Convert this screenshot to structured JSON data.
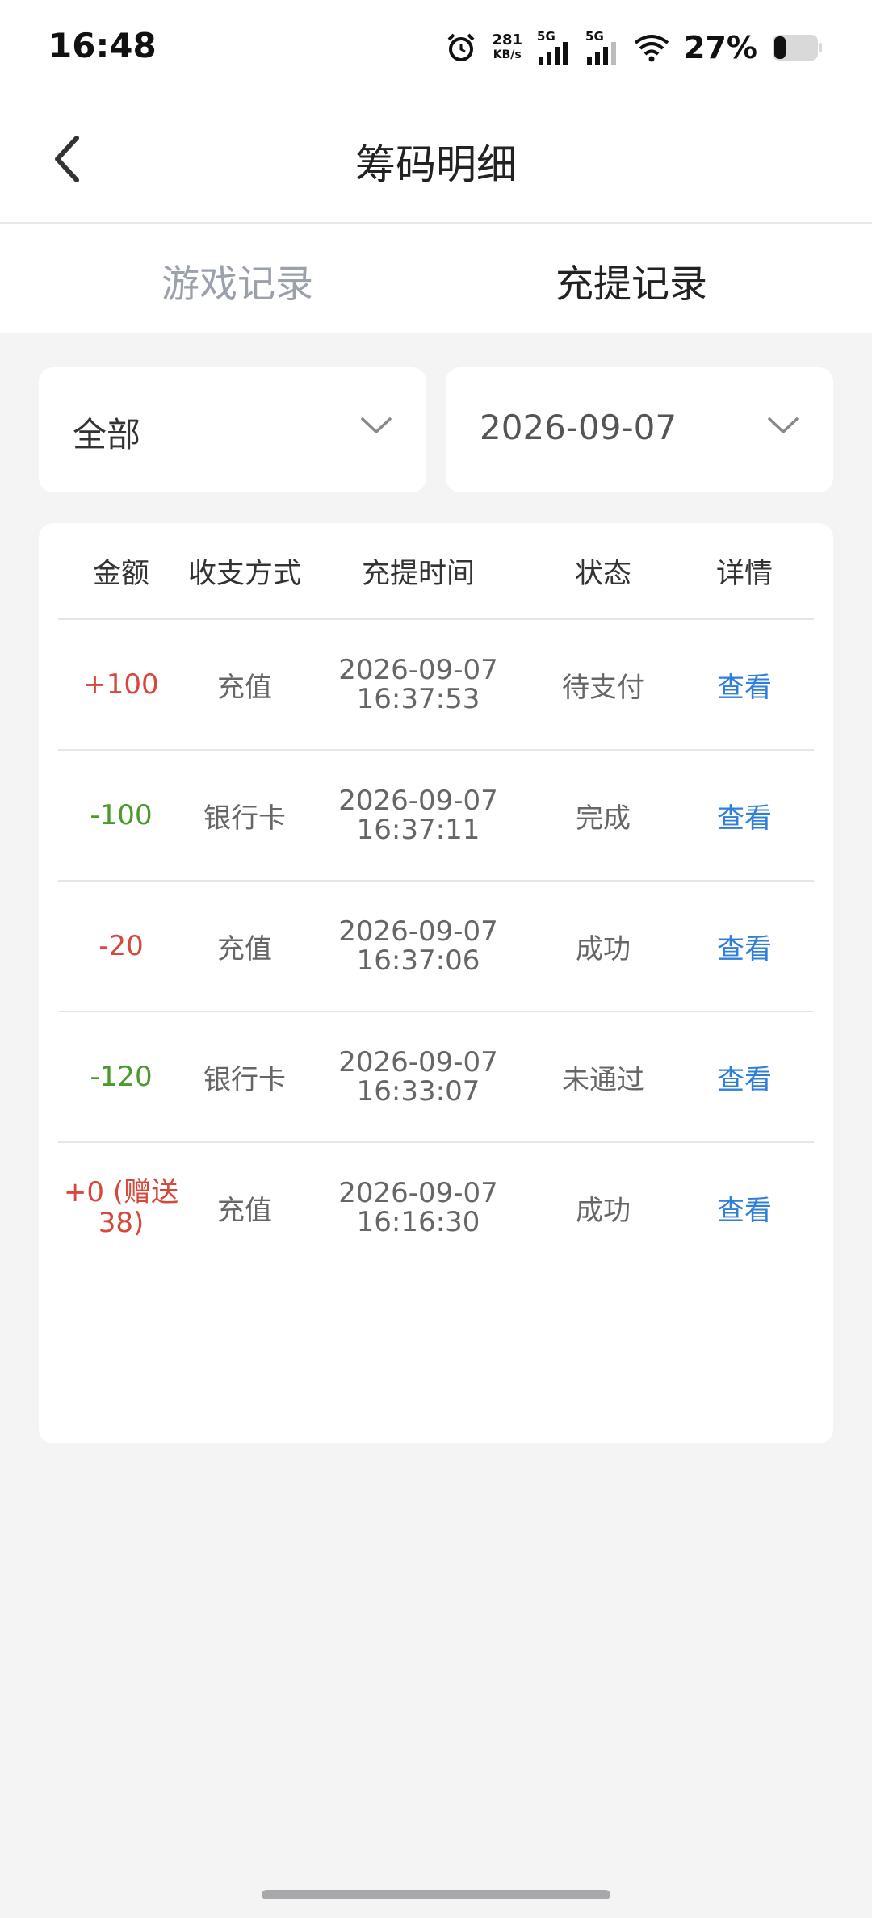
{
  "status_bar": {
    "time": "16:48",
    "net_speed_value": "281",
    "net_speed_unit": "KB/s",
    "sim1_tag": "5G",
    "sim2_tag": "5G",
    "battery": "27%"
  },
  "header": {
    "title": "筹码明细"
  },
  "tabs": [
    {
      "label": "游戏记录",
      "active": false
    },
    {
      "label": "充提记录",
      "active": true
    }
  ],
  "filters": {
    "type_value": "全部",
    "date_value": "2026-09-07"
  },
  "table": {
    "columns": [
      "金额",
      "收支方式",
      "充提时间",
      "状态",
      "详情"
    ],
    "rows": [
      {
        "amount": "+100",
        "method": "充值",
        "date": "2026-09-07",
        "time": "16:37:53",
        "status": "待支付",
        "detail": "查看"
      },
      {
        "amount": "-100",
        "method": "银行卡",
        "date": "2026-09-07",
        "time": "16:37:11",
        "status": "完成",
        "detail": "查看"
      },
      {
        "amount": "-20",
        "method": "充值",
        "date": "2026-09-07",
        "time": "16:37:06",
        "status": "成功",
        "detail": "查看"
      },
      {
        "amount": "-120",
        "method": "银行卡",
        "date": "2026-09-07",
        "time": "16:33:07",
        "status": "未通过",
        "detail": "查看"
      },
      {
        "amount_line1": "+0 (赠送",
        "amount_line2": "38)",
        "method": "充值",
        "date": "2026-09-07",
        "time": "16:16:30",
        "status": "成功",
        "detail": "查看"
      }
    ]
  },
  "colors": {
    "positive": "#d6483b",
    "negative": "#4a9a2c",
    "link": "#2f7ed8"
  }
}
